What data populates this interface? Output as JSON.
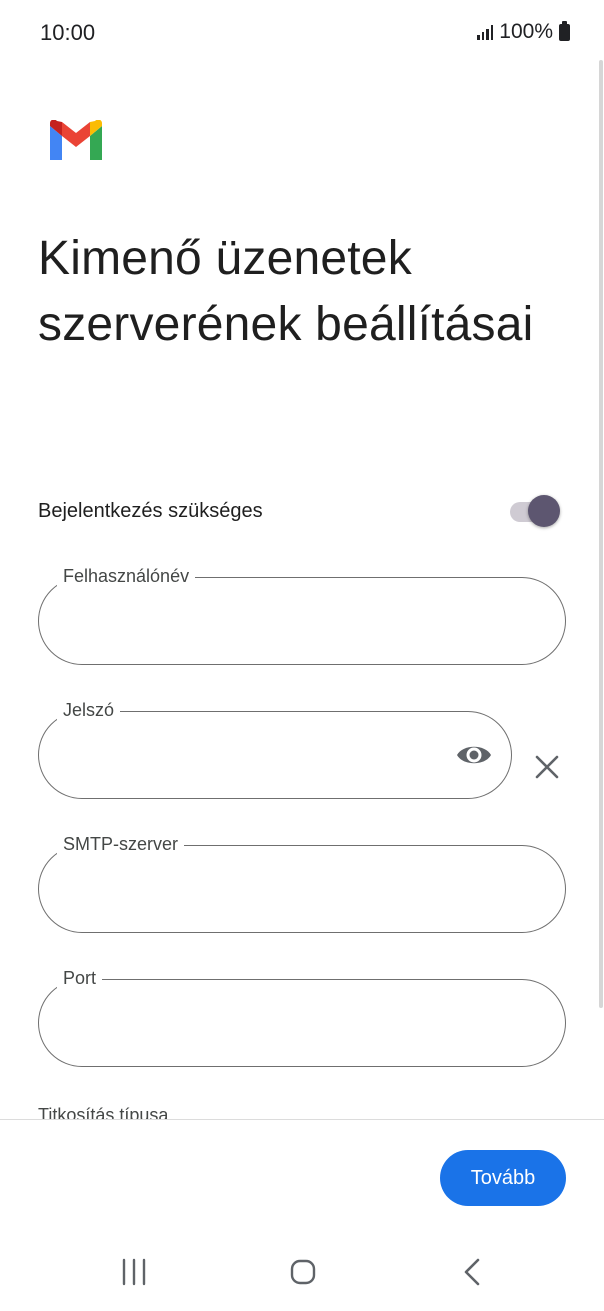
{
  "status_bar": {
    "time": "10:00",
    "battery": "100%"
  },
  "app": {
    "logo": "gmail-logo"
  },
  "page": {
    "title": "Kimenő üzenetek szerverének beállításai"
  },
  "login_toggle": {
    "label": "Bejelentkezés szükséges",
    "on": true
  },
  "fields": {
    "username": {
      "label": "Felhasználónév",
      "value": ""
    },
    "password": {
      "label": "Jelszó",
      "value": ""
    },
    "smtp_server": {
      "label": "SMTP-szerver",
      "value": ""
    },
    "port": {
      "label": "Port",
      "value": ""
    }
  },
  "next_section_label": "Titkosítás típusa",
  "actions": {
    "next_button": "Tovább"
  },
  "icons": {
    "password_visibility": "eye-icon",
    "clear": "close-icon",
    "nav_recents": "recents-icon",
    "nav_home": "home-icon",
    "nav_back": "back-icon"
  },
  "colors": {
    "accent": "#1a73e8",
    "toggle_thumb": "#5d5670"
  }
}
